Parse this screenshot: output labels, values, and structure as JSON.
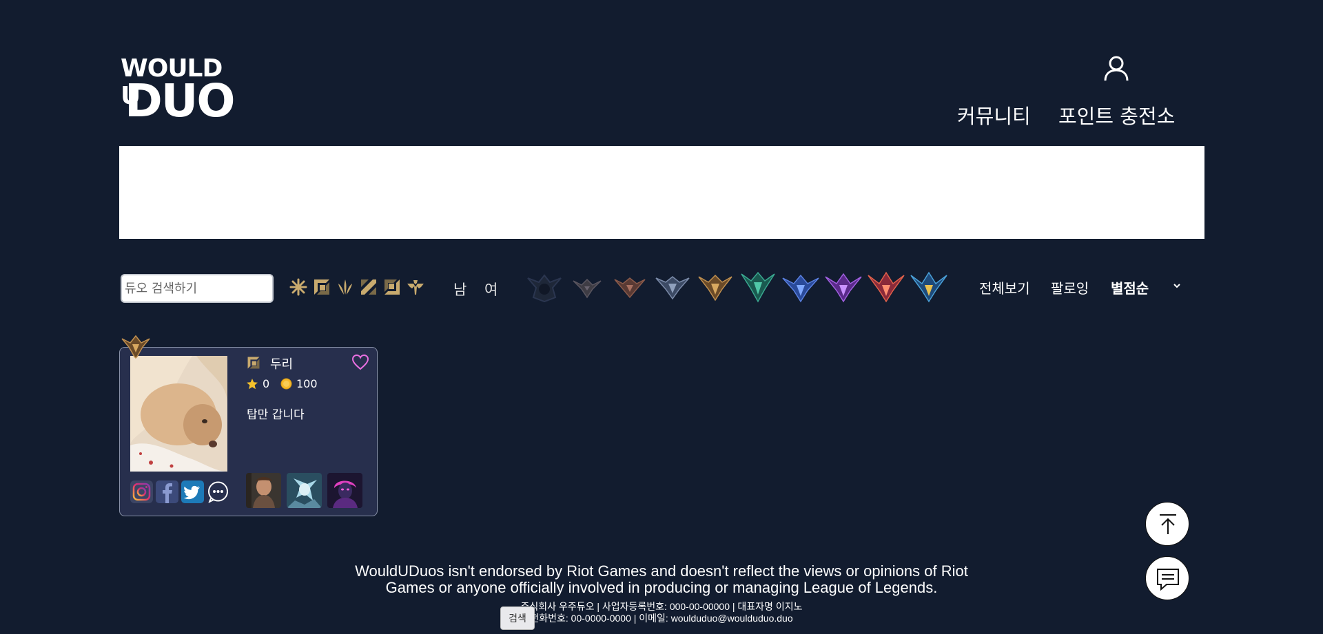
{
  "header": {
    "logo_line1": "WOULD U",
    "logo_line2": "DUO",
    "nav": [
      "커뮤니티",
      "포인트 충전소"
    ]
  },
  "filters": {
    "search_placeholder": "듀오 검색하기",
    "position_icons": [
      "all-positions-icon",
      "top-icon",
      "jungle-icon",
      "mid-icon",
      "bottom-icon",
      "support-icon"
    ],
    "gender": [
      "남",
      "여"
    ],
    "tier_icons": [
      "unranked-icon",
      "iron-icon",
      "bronze-icon",
      "silver-icon",
      "gold-icon",
      "platinum-icon",
      "diamond-icon",
      "master-icon",
      "grandmaster-icon",
      "challenger-icon"
    ],
    "sort_options": [
      "전체보기",
      "팔로잉",
      "별점순"
    ],
    "active_sort": "별점순"
  },
  "cards": [
    {
      "tier_badge": "gold-badge-icon",
      "position_icon": "top-icon",
      "name": "두리",
      "rating": "0",
      "points": "100",
      "memo": "탑만 갑니다",
      "socials": [
        "instagram-icon",
        "facebook-icon",
        "twitter-icon",
        "chat-icon"
      ],
      "champions": [
        "champion-1",
        "champion-2",
        "champion-3"
      ]
    }
  ],
  "footer": {
    "disclaimer_line1": "WouldUDuos isn't endorsed by Riot Games and doesn't reflect the views or opinions of Riot",
    "disclaimer_line2": "Games or anyone officially involved in producing or managing League of Legends.",
    "company_line": "주식회사 우주듀오 | 사업자등록번호: 000-00-00000 | 대표자명 이지노",
    "contact_line": "전화번호: 00-0000-0000 | 이메일: woulduduo@woulduduo.duo",
    "search_button": "검색"
  },
  "colors": {
    "background": "#121c2f",
    "card": "#272f4d",
    "heart": "#e86fe0",
    "gold": "#f5c12b"
  }
}
